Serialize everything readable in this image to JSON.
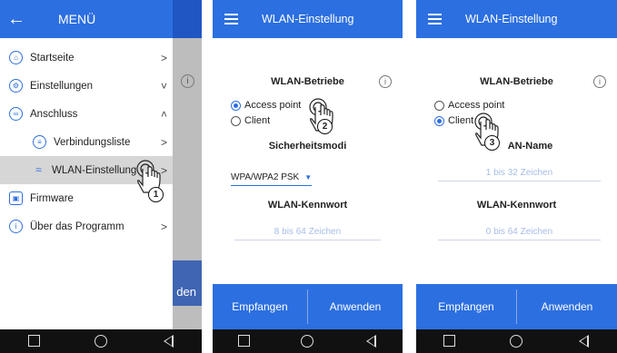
{
  "panel1": {
    "header_title": "MENÜ",
    "behind_button": "den",
    "items": [
      {
        "label": "Startseite",
        "arrow": ">"
      },
      {
        "label": "Einstellungen",
        "arrow": "˅"
      },
      {
        "label": "Anschluss",
        "arrow": "˄"
      },
      {
        "label": "Verbindungsliste",
        "arrow": ">"
      },
      {
        "label": "WLAN-Einstellung",
        "arrow": ">"
      },
      {
        "label": "Firmware",
        "arrow": ""
      },
      {
        "label": "Über das Programm",
        "arrow": ">"
      }
    ],
    "step": "1"
  },
  "panel2": {
    "title": "WLAN-Einstellung",
    "section": "WLAN-Betriebe",
    "radio_ap": "Access point",
    "radio_client": "Client",
    "security_title": "Sicherheitsmodi",
    "security_value": "WPA/WPA2 PSK",
    "pw_title": "WLAN-Kennwort",
    "pw_placeholder": "8 bis 64 Zeichen",
    "btn_receive": "Empfangen",
    "btn_apply": "Anwenden",
    "step": "2"
  },
  "panel3": {
    "title": "WLAN-Einstellung",
    "section": "WLAN-Betriebe",
    "radio_ap": "Access point",
    "radio_client": "Client",
    "name_title": "AN-Name",
    "name_placeholder": "1 bis 32 Zeichen",
    "pw_title": "WLAN-Kennwort",
    "pw_placeholder": "0  bis 64 Zeichen",
    "btn_receive": "Empfangen",
    "btn_apply": "Anwenden",
    "step": "3"
  },
  "colors": {
    "accent": "#2c6fe0",
    "placeholder": "#a6bde8",
    "navbar": "#111111"
  },
  "icons": [
    "back-arrow-icon",
    "menu-icon",
    "info-icon",
    "home-icon",
    "settings-icon",
    "connection-icon",
    "list-icon",
    "wifi-icon",
    "firmware-icon",
    "hand-pointer-icon"
  ]
}
